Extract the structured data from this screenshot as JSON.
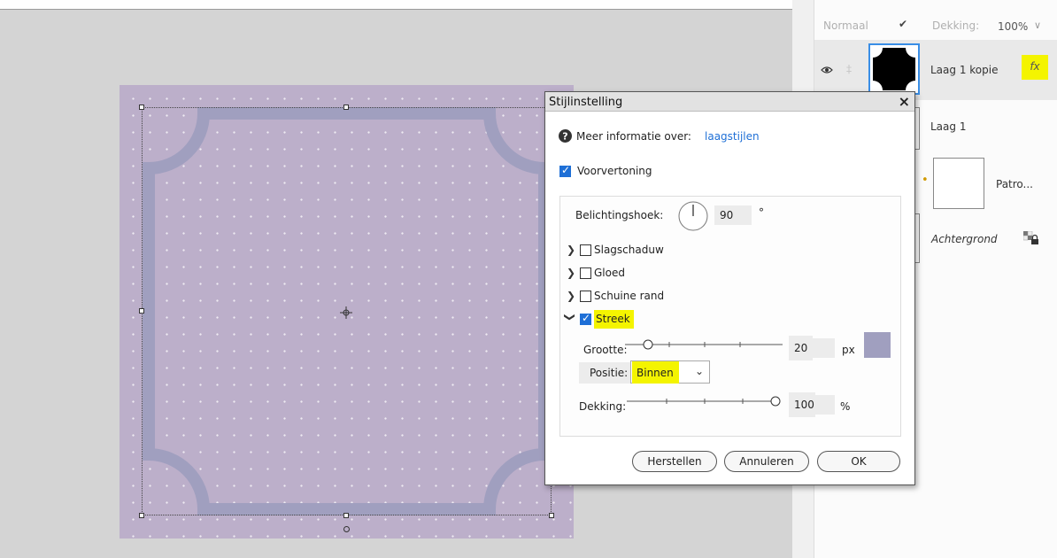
{
  "layers_panel": {
    "blend_mode": "Normaal",
    "opacity_label": "Dekking:",
    "opacity_value": "100%",
    "layers": [
      {
        "name": "Laag 1 kopie",
        "fx": "fx"
      },
      {
        "name": "Laag 1"
      },
      {
        "name": "Patro..."
      },
      {
        "name": "Achtergrond"
      }
    ]
  },
  "dialog": {
    "title": "Stijlinstelling",
    "close": "×",
    "info_label": "Meer informatie over:",
    "info_link": "laagstijlen",
    "preview_label": "Voorvertoning",
    "angle_label": "Belichtingshoek:",
    "angle_value": "90",
    "angle_unit": "°",
    "effects": [
      {
        "label": "Slagschaduw",
        "checked": false
      },
      {
        "label": "Gloed",
        "checked": false
      },
      {
        "label": "Schuine rand",
        "checked": false
      },
      {
        "label": "Streek",
        "checked": true
      }
    ],
    "stroke": {
      "size_label": "Grootte:",
      "size_value": "20",
      "size_unit": "px",
      "color": "#a09fbf",
      "position_label": "Positie:",
      "position_value": "Binnen",
      "opacity_label": "Dekking:",
      "opacity_value": "100",
      "opacity_unit": "%"
    },
    "buttons": {
      "reset": "Herstellen",
      "cancel": "Annuleren",
      "ok": "OK"
    }
  },
  "colors": {
    "canvas_bg": "#bcafca",
    "frame_stroke": "#a09fbf",
    "highlight": "#f4f400",
    "checkbox_on": "#1e6fd6",
    "link": "#1e6fd6"
  }
}
